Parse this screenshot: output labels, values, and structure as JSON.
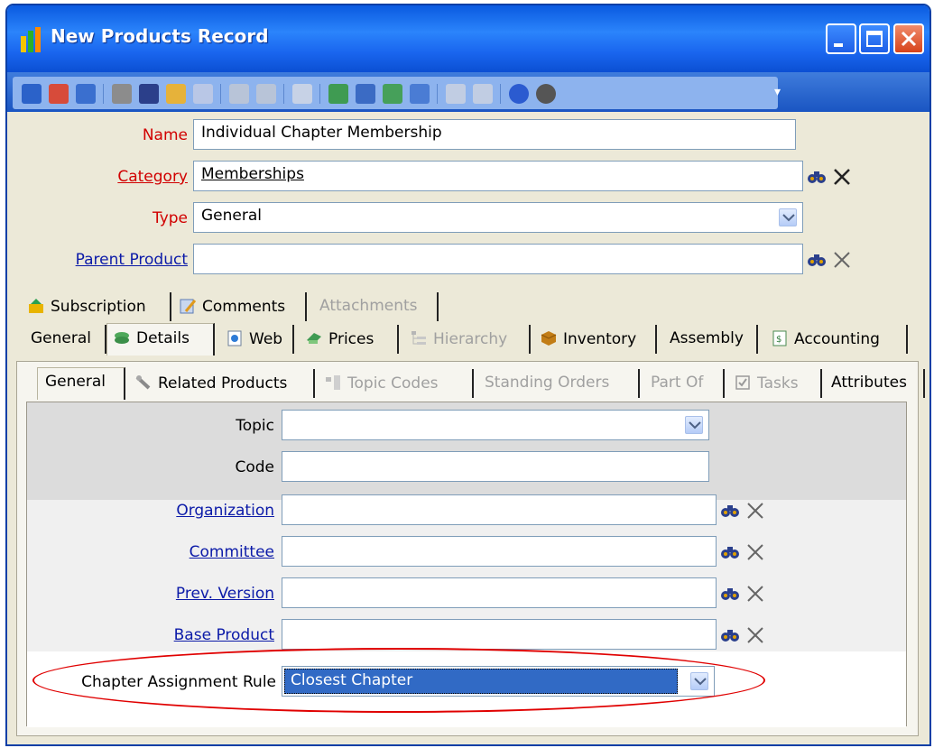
{
  "window": {
    "title": "New Products Record"
  },
  "toolbar": {
    "icons": [
      "save-icon",
      "save-close-icon",
      "save-new-icon",
      "print-icon",
      "find-icon",
      "open-folder-icon",
      "list-icon",
      "forward-icon",
      "delete-icon",
      "grid-icon",
      "move-icon",
      "copy-icon",
      "web-icon",
      "refresh-icon",
      "link-icon",
      "attach-icon",
      "help-icon",
      "info-icon"
    ]
  },
  "form": {
    "name_label": "Name",
    "name_value": "Individual Chapter Membership",
    "category_label": "Category",
    "category_value": "Memberships",
    "type_label": "Type",
    "type_value": "General",
    "parent_label": "Parent Product",
    "parent_value": ""
  },
  "tabs": {
    "row1": [
      {
        "label": "Subscription",
        "icon": "subscription-icon"
      },
      {
        "label": "Comments",
        "icon": "comments-icon"
      },
      {
        "label": "Attachments",
        "icon": ""
      }
    ],
    "row2": [
      {
        "label": "General",
        "icon": ""
      },
      {
        "label": "Details",
        "icon": "details-icon"
      },
      {
        "label": "Web",
        "icon": "web-icon"
      },
      {
        "label": "Prices",
        "icon": "prices-icon"
      },
      {
        "label": "Hierarchy",
        "icon": "hierarchy-icon"
      },
      {
        "label": "Inventory",
        "icon": "inventory-icon"
      },
      {
        "label": "Assembly",
        "icon": ""
      },
      {
        "label": "Accounting",
        "icon": "accounting-icon"
      }
    ]
  },
  "subtabs": [
    {
      "label": "General"
    },
    {
      "label": "Related Products"
    },
    {
      "label": "Topic Codes"
    },
    {
      "label": "Standing Orders"
    },
    {
      "label": "Part Of"
    },
    {
      "label": "Tasks"
    },
    {
      "label": "Attributes"
    }
  ],
  "details": {
    "topic_label": "Topic",
    "topic_value": "",
    "code_label": "Code",
    "code_value": "",
    "organization_label": "Organization",
    "committee_label": "Committee",
    "prev_version_label": "Prev. Version",
    "base_product_label": "Base Product",
    "chapter_rule_label": "Chapter Assignment Rule",
    "chapter_rule_value": "Closest Chapter"
  },
  "colors": {
    "title_bar": "#1a66ef",
    "required_label": "#d10000",
    "link_label": "#0b1aa8",
    "selection": "#316ac5",
    "highlight": "#e00000"
  }
}
